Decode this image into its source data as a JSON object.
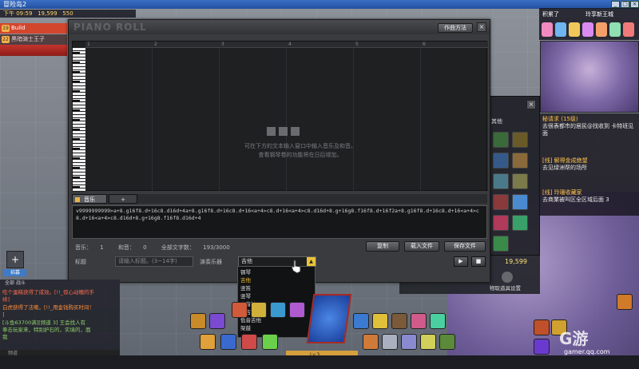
{
  "window": {
    "title": "冒险岛2"
  },
  "status_bar": {
    "time": "下午 09:59",
    "gold": "19,599",
    "extra": "550"
  },
  "quests_left": [
    {
      "num": "19",
      "label": "Build"
    },
    {
      "num": "22",
      "label": "黑暗骑士王子"
    }
  ],
  "top_right": {
    "label_a": "积累了",
    "label_b": "玲享新王城"
  },
  "quest_panel": [
    {
      "title": "秘请求 (15级)",
      "sub": "去很表都市的居民@找收到 卡特班见面"
    },
    {
      "title": "[线] 解得金成绝望",
      "sub": "去见绿洲帮的场所"
    },
    {
      "title": "[线] 玲珊收藏家",
      "sub": "去商業被叫区全区域后面 3"
    }
  ],
  "inventory": {
    "tab": "其他",
    "money": "19,599",
    "settings_label": "物取道具设置"
  },
  "composer": {
    "logo_text": "PIANO ROLL",
    "help_button": "作曲方法",
    "ruler_numbers": [
      "1",
      "2",
      "3",
      "4",
      "5",
      "6"
    ],
    "hint_line1": "可在下方的文本输入窗口中输入音乐及和音。",
    "hint_line2": "查看钢琴卷的功能将在日后增加。",
    "tab_music": "音乐",
    "tab_add": "+",
    "mml": "v9999999999>a+8.g16f8.d+16c8.d16d+4a+8.g16f8.d+16c8.d+16<a+4>c8.d+16<a+4>c8.d16d+8.g+16g8.f16f8.d+16f2a+8.g16f8.d+16c8.d+16<a+4>c8.d+16<a+4>c8.d16d+8.g+16g8.f16f8.d16d+4",
    "stat_music_label": "音乐：",
    "stat_music_val": "1",
    "stat_harmony_label": "和音：",
    "stat_harmony_val": "0",
    "stat_chars_label": "全部文字数：",
    "stat_chars_val": "193/3000",
    "copy_button": "复制",
    "load_button": "载入文件",
    "save_button": "保存文件",
    "title_label": "标题",
    "title_placeholder": "请输入标题。(3~14字)",
    "instrument_label": "演奏乐器",
    "instrument_selected": "吉他",
    "play_symbol": "▶",
    "stop_symbol": "■"
  },
  "instrument_options": [
    "钢琴",
    "吉他",
    "竖笛",
    "竖琴",
    "定音鼓",
    "电吉他",
    "低音吉他",
    "架鼓"
  ],
  "chat": {
    "tabs": "全部  战斗",
    "lines": [
      {
        "text": "吃个蛋糕获得了成效。[!!_惊心动魄的手",
        "color": "#ff6a4d"
      },
      {
        "text": "续]",
        "color": "#ff6a4d"
      },
      {
        "text": "白虎获得了法嗽。[!!_用金钱购买时间！",
        "color": "#ff8f3c"
      },
      {
        "text": "]",
        "color": "#ff8f3c"
      },
      {
        "text": "[斗鱼63700满][频道 3] 王会找人有",
        "color": "#8fd06b"
      },
      {
        "text": "拳击玩家来，特别护石的，实境的，面",
        "color": "#8fd06b"
      },
      {
        "text": "我",
        "color": "#8fd06b"
      }
    ],
    "input_label": "频道"
  },
  "side": {
    "plus": "+",
    "label": "招募"
  },
  "watermark": {
    "main": "G游",
    "sub": "gamer.qq.com"
  },
  "hud": {
    "level_text": "Lv.3"
  }
}
